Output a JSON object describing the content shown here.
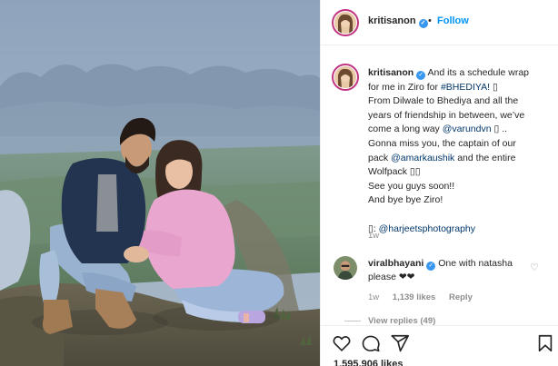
{
  "post": {
    "username": "kritisanon",
    "follow_label": "Follow",
    "separator": "•"
  },
  "caption": {
    "username": "kritisanon",
    "lines": [
      "And its a schedule wrap for me in Ziro for #BHEDIYA! ",
      "From Dilwale to Bhediya and all the years of friendship in between, we’ve come a long way @varundvn ..",
      "Gonna miss you, the captain of our pack @amarkaushik and the entire Wolfpack ",
      "See you guys soon!!",
      "And bye bye Ziro!",
      "",
      ": @harjeetsphotography"
    ],
    "l1_a": "And its a schedule wrap",
    "l1_b": "for me in Ziro for ",
    "hashtag": "#BHEDIYA!",
    "l2": "From Dilwale to Bhediya and all the",
    "l3": "years of friendship in between, we’ve",
    "l4_a": "come a long way ",
    "mention1": "@varundvn",
    "l4_b": " ..",
    "l5": "Gonna miss you, the captain of our",
    "l6_a": "pack ",
    "mention2": "@amarkaushik",
    "l6_b": " and the entire",
    "l7": "Wolfpack",
    "l8": "See you guys soon!!",
    "l9": "And bye bye Ziro!",
    "photo_credit": "@harjeetsphotography",
    "time": "1w"
  },
  "comment": {
    "username": "viralbhayani",
    "text": "One with natasha please ❤❤",
    "time": "1w",
    "likes": "1,139 likes",
    "reply_label": "Reply",
    "view_replies": "View replies (49)"
  },
  "footer": {
    "likes": "1,595,906 likes"
  },
  "icons": {
    "verified": "verified-badge-icon",
    "heart": "heart-icon",
    "comment": "comment-icon",
    "share": "share-icon",
    "save": "bookmark-icon"
  },
  "colors": {
    "follow": "#0095f6",
    "verified": "#3897f0",
    "link": "#00376b",
    "muted": "#8e8e8e",
    "story_ring": "#c13584"
  }
}
